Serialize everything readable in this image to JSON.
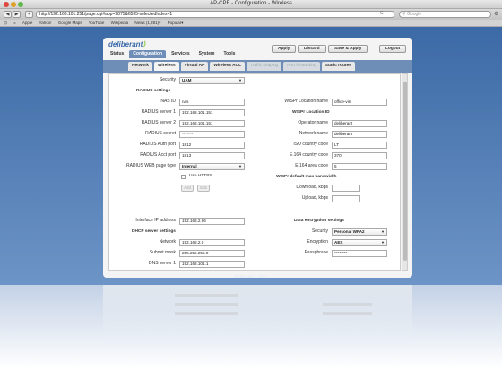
{
  "window": {
    "title": "AP-CPE - Configuration - Wireless"
  },
  "browser": {
    "url": "http://192.168.101.251/page.cgi#app=9875&6595-selectedIndex=1",
    "search_placeholder": "Google",
    "back": "◀",
    "forward": "▶",
    "add": "+",
    "reload": "C",
    "bookmarks": [
      "Apple",
      "Yahoo!",
      "Google Maps",
      "YouTube",
      "Wikipedia",
      "News (1,281)▾",
      "Popular▾"
    ]
  },
  "app": {
    "logo_main": "deliberant",
    "logo_mark": "⟩",
    "main_tabs": [
      "Status",
      "Configuration",
      "Services",
      "System",
      "Tools"
    ],
    "active_main_tab": 1,
    "actions": {
      "apply": "Apply",
      "discard": "Discard",
      "save_apply": "Save & Apply",
      "logout": "Logout"
    },
    "sub_tabs": [
      "Network",
      "Wireless",
      "Virtual AP",
      "Wireless ACL",
      "Traffic shaping",
      "Port forwarding",
      "Static routes"
    ],
    "active_sub_tab": 1,
    "footer": "Deliberant © 2011"
  },
  "left": {
    "security": {
      "label": "Security",
      "value": "UAM"
    },
    "radius_header": "RADIUS settings",
    "nas_id": {
      "label": "NAS ID",
      "value": "nas"
    },
    "radius_server_1": {
      "label": "RADIUS server 1",
      "value": "192.168.101.151"
    },
    "radius_server_2": {
      "label": "RADIUS server 2",
      "value": "192.168.101.151"
    },
    "radius_secret": {
      "label": "RADIUS secret",
      "value": "*******"
    },
    "radius_auth_port": {
      "label": "RADIUS Auth port",
      "value": "1812"
    },
    "radius_acct_port": {
      "label": "RADIUS Acct port",
      "value": "1813"
    },
    "radius_web_page_type": {
      "label": "RADIUS WEB page type",
      "value": "Internal"
    },
    "use_https": "Use HTTPS",
    "add_btn": "Add",
    "edit_btn": "Edit",
    "interface_ip": {
      "label": "Interface IP address",
      "value": "192.168.2.66"
    },
    "dhcp_header": "DHCP server settings",
    "network": {
      "label": "Network",
      "value": "192.168.2.0"
    },
    "subnet_mask": {
      "label": "Subnet mask",
      "value": "255.255.255.0"
    },
    "dns_server_1": {
      "label": "DNS server 1",
      "value": "192.168.101.1"
    }
  },
  "right": {
    "wispr_location_name": {
      "label": "WISPr Location name",
      "value": "office-vin"
    },
    "wispr_location_header": "WISPr Location ID",
    "operator_name": {
      "label": "Operator name",
      "value": "deliberant"
    },
    "network_name": {
      "label": "Network name",
      "value": "deliberant"
    },
    "iso_country": {
      "label": "ISO country code",
      "value": "LT"
    },
    "e164_country": {
      "label": "E.164 country code",
      "value": "370"
    },
    "e164_area": {
      "label": "E.164 area code",
      "value": "5"
    },
    "bandwidth_header": "WISPr default max bandwidth",
    "download": {
      "label": "Download, kbps",
      "value": ""
    },
    "upload": {
      "label": "Upload, kbps",
      "value": ""
    },
    "encryption_header": "Data encryption settings",
    "security": {
      "label": "Security",
      "value": "Personal WPA2"
    },
    "encryption": {
      "label": "Encryption",
      "value": "AES"
    },
    "passphrase": {
      "label": "Passphrase",
      "value": "********"
    }
  },
  "colors": {
    "accent": "#6e8eb8",
    "logo": "#3a6aa8",
    "logo_mark": "#8cc63f",
    "desktop": "#5a7fb0"
  }
}
